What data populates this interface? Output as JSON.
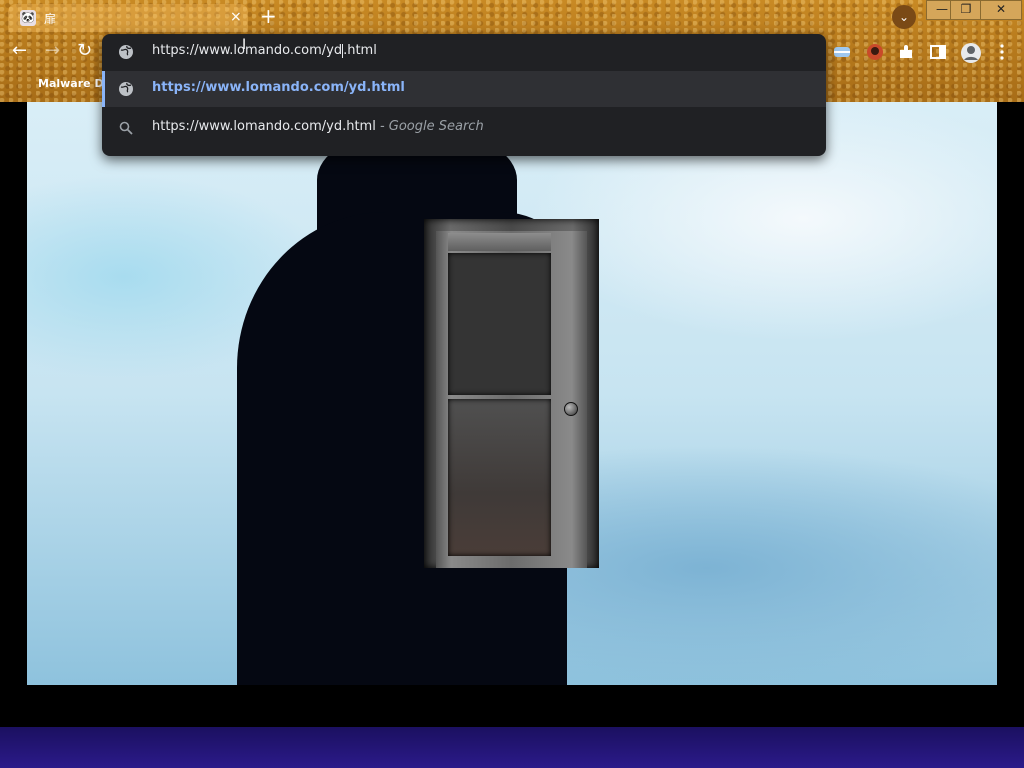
{
  "browser": {
    "tab": {
      "favicon": "🐼",
      "title": "扉",
      "close": "×"
    },
    "new_tab": "+",
    "window_controls": {
      "minimize": "—",
      "restore": "❐",
      "close": "✕"
    },
    "tab_search": "⌄",
    "nav": {
      "back": "←",
      "forward": "→",
      "reload": "↻"
    },
    "bookmark_label": "Malware Dat",
    "toolbar_icons": [
      "flag-icon",
      "profile-pic-icon",
      "extensions-icon",
      "side-panel-icon",
      "account-icon",
      "menu-icon"
    ]
  },
  "omnibox": {
    "input_before_caret": "https://www.lomando.com/yd",
    "input_after_caret": ".html",
    "suggestions": [
      {
        "text": "https://www.lomando.com/yd.html",
        "icon": "globe-icon",
        "selected": true
      },
      {
        "text": "https://www.lomando.com/yd.html",
        "suffix": " - Google Search",
        "icon": "search-icon",
        "selected": false
      }
    ]
  },
  "colors": {
    "omnibox_bg": "#202124",
    "selected_link": "#8ab4f8",
    "chrome_theme": "#b77a1d"
  }
}
